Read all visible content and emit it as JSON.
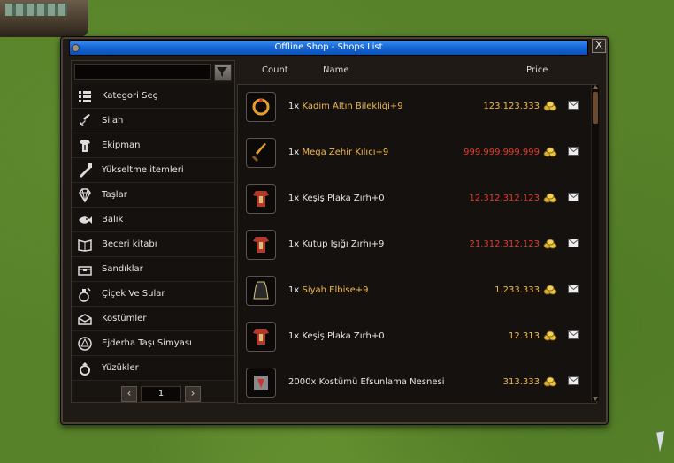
{
  "window": {
    "title": "Offline Shop - Shops List",
    "close_label": "X"
  },
  "colors": {
    "name_highlight": "#f1b94b",
    "price_normal": "#f1b94b",
    "price_high": "#e83a2d",
    "title_bar": "#1466d6"
  },
  "search": {
    "placeholder": "",
    "value": "",
    "filter_icon": "filter-icon"
  },
  "categories": [
    {
      "label": "Kategori Seç",
      "icon": "list-icon"
    },
    {
      "label": "Silah",
      "icon": "sword-icon"
    },
    {
      "label": "Ekipman",
      "icon": "armor-icon"
    },
    {
      "label": "Yükseltme itemleri",
      "icon": "upgrade-icon"
    },
    {
      "label": "Taşlar",
      "icon": "diamond-icon"
    },
    {
      "label": "Balık",
      "icon": "fish-icon"
    },
    {
      "label": "Beceri kitabı",
      "icon": "book-icon"
    },
    {
      "label": "Sandıklar",
      "icon": "chest-icon"
    },
    {
      "label": "Çiçek Ve Sular",
      "icon": "potion-icon"
    },
    {
      "label": "Kostümler",
      "icon": "costume-icon"
    },
    {
      "label": "Ejderha Taşı Simyası",
      "icon": "alchemy-icon"
    },
    {
      "label": "Yüzükler",
      "icon": "ring-icon"
    }
  ],
  "pager": {
    "page": "1",
    "prev_icon": "chevron-left-icon",
    "next_icon": "chevron-right-icon"
  },
  "columns": {
    "count": "Count",
    "name": "Name",
    "price": "Price"
  },
  "items": [
    {
      "count": "1x",
      "name": "Kadim Altın Bilekliği+9",
      "price": "123.123.333",
      "name_color": "highlight",
      "price_color": "normal",
      "icon": "bracelet-icon"
    },
    {
      "count": "1x",
      "name": "Mega Zehir Kılıcı+9",
      "price": "999.999.999.999",
      "name_color": "highlight",
      "price_color": "high",
      "icon": "sword-item-icon"
    },
    {
      "count": "1x",
      "name": "Keşiş Plaka Zırh+0",
      "price": "12.312.312.123",
      "name_color": "white",
      "price_color": "high",
      "icon": "armor-item-icon"
    },
    {
      "count": "1x",
      "name": "Kutup Işığı Zırhı+9",
      "price": "21.312.312.123",
      "name_color": "white",
      "price_color": "high",
      "icon": "armor-item-icon"
    },
    {
      "count": "1x",
      "name": "Siyah Elbise+9",
      "price": "1.233.333",
      "name_color": "highlight",
      "price_color": "normal",
      "icon": "dress-item-icon"
    },
    {
      "count": "1x",
      "name": "Keşiş Plaka Zırh+0",
      "price": "12.313",
      "name_color": "white",
      "price_color": "normal",
      "icon": "armor-item-icon"
    },
    {
      "count": "2000x",
      "name": "Kostümü Efsunlama Nesnesi",
      "price": "313.333",
      "name_color": "white",
      "price_color": "normal",
      "icon": "enchant-item-icon"
    }
  ]
}
